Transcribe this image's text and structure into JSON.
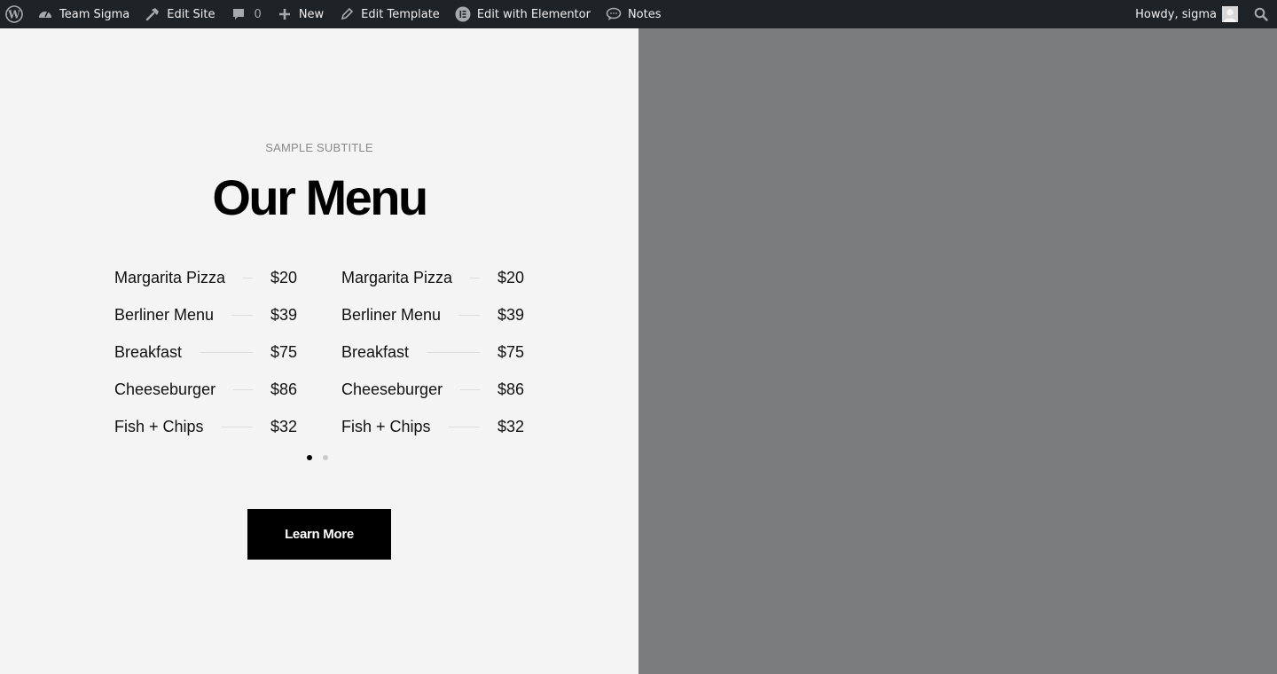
{
  "adminbar": {
    "wp_logo_icon": "wordpress-icon",
    "site_name": "Team Sigma",
    "edit_site": "Edit Site",
    "comments_count": "0",
    "new": "New",
    "edit_template": "Edit Template",
    "edit_elementor": "Edit with Elementor",
    "notes": "Notes",
    "howdy": "Howdy, sigma"
  },
  "menu": {
    "subtitle": "SAMPLE SUBTITLE",
    "title": "Our Menu",
    "column1": [
      {
        "name": "Margarita Pizza",
        "price": "$20"
      },
      {
        "name": "Berliner Menu",
        "price": "$39"
      },
      {
        "name": "Breakfast",
        "price": "$75"
      },
      {
        "name": "Cheeseburger",
        "price": "$86"
      },
      {
        "name": "Fish + Chips",
        "price": "$32"
      }
    ],
    "column2": [
      {
        "name": "Margarita Pizza",
        "price": "$20"
      },
      {
        "name": "Berliner Menu",
        "price": "$39"
      },
      {
        "name": "Breakfast",
        "price": "$75"
      },
      {
        "name": "Cheeseburger",
        "price": "$86"
      },
      {
        "name": "Fish + Chips",
        "price": "$32"
      }
    ],
    "slider_active_index": 0,
    "slider_count": 2,
    "button_label": "Learn More"
  },
  "colors": {
    "adminbar_bg": "#1d2327",
    "left_bg": "#f4f4f4",
    "right_bg": "#7b7c7e",
    "button_bg": "#000000"
  }
}
